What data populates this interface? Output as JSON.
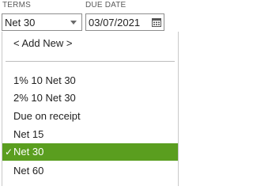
{
  "fields": {
    "terms_label": "TERMS",
    "due_date_label": "DUE DATE",
    "terms_value": "Net 30",
    "due_date_value": "03/07/2021"
  },
  "icons": {
    "dropdown": "chevron-down-icon",
    "calendar": "calendar-icon"
  },
  "menu": {
    "add_new": "< Add New >",
    "items": [
      "1% 10 Net 30",
      "2% 10 Net 30",
      "Due on receipt",
      "Net 15",
      "Net 30",
      "Net 60"
    ],
    "selected": "Net 30",
    "check_mark": "✓"
  },
  "colors": {
    "selected_bg": "#5a9e1f",
    "selected_text": "#ffffff"
  }
}
